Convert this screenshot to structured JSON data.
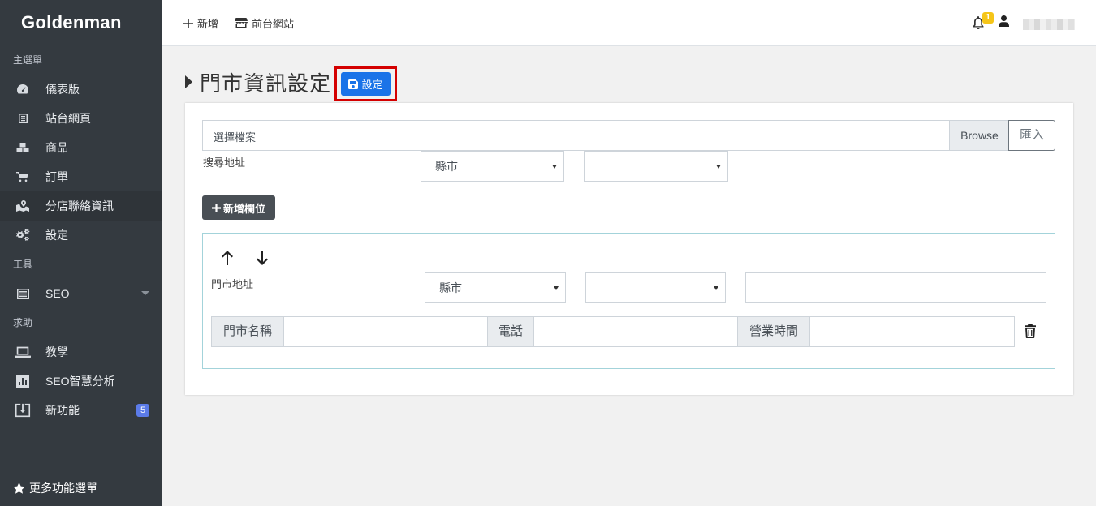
{
  "sidebar": {
    "brand": "Goldenman",
    "sections": {
      "main": "主選單",
      "tools": "工具",
      "help": "求助"
    },
    "items": [
      {
        "label": "儀表版",
        "icon": "dashboard-icon"
      },
      {
        "label": "站台網頁",
        "icon": "page-icon"
      },
      {
        "label": "商品",
        "icon": "boxes-icon"
      },
      {
        "label": "訂單",
        "icon": "cart-icon"
      },
      {
        "label": "分店聯絡資訊",
        "icon": "map-marker-icon",
        "active": true
      },
      {
        "label": "設定",
        "icon": "gears-icon"
      },
      {
        "label": "SEO",
        "icon": "list-icon"
      },
      {
        "label": "教學",
        "icon": "laptop-icon"
      },
      {
        "label": "SEO智慧分析",
        "icon": "bar-chart-icon"
      },
      {
        "label": "新功能",
        "icon": "download-icon",
        "badge": "5"
      }
    ],
    "footer": "更多功能選單"
  },
  "topbar": {
    "add_label": "新增",
    "frontend_label": "前台網站",
    "notification_count": "1"
  },
  "page": {
    "title": "門市資訊設定",
    "save_label": "設定"
  },
  "form": {
    "file_placeholder": "選擇檔案",
    "browse_label": "Browse",
    "import_label": "匯入",
    "search_address_label": "搜尋地址",
    "county_select": "縣市",
    "district_select": "",
    "add_field_label": "新增欄位"
  },
  "store": {
    "address_label": "門市地址",
    "county_select": "縣市",
    "district_select": "",
    "address_value": "",
    "name_addon": "門市名稱",
    "name_value": "",
    "phone_addon": "電話",
    "phone_value": "",
    "hours_addon": "營業時間",
    "hours_value": ""
  },
  "colors": {
    "sidebar_bg": "#343a40",
    "primary": "#1a73e8",
    "highlight": "#d40000",
    "badge_yellow": "#f5c518",
    "badge_blue": "#5b7be9"
  }
}
